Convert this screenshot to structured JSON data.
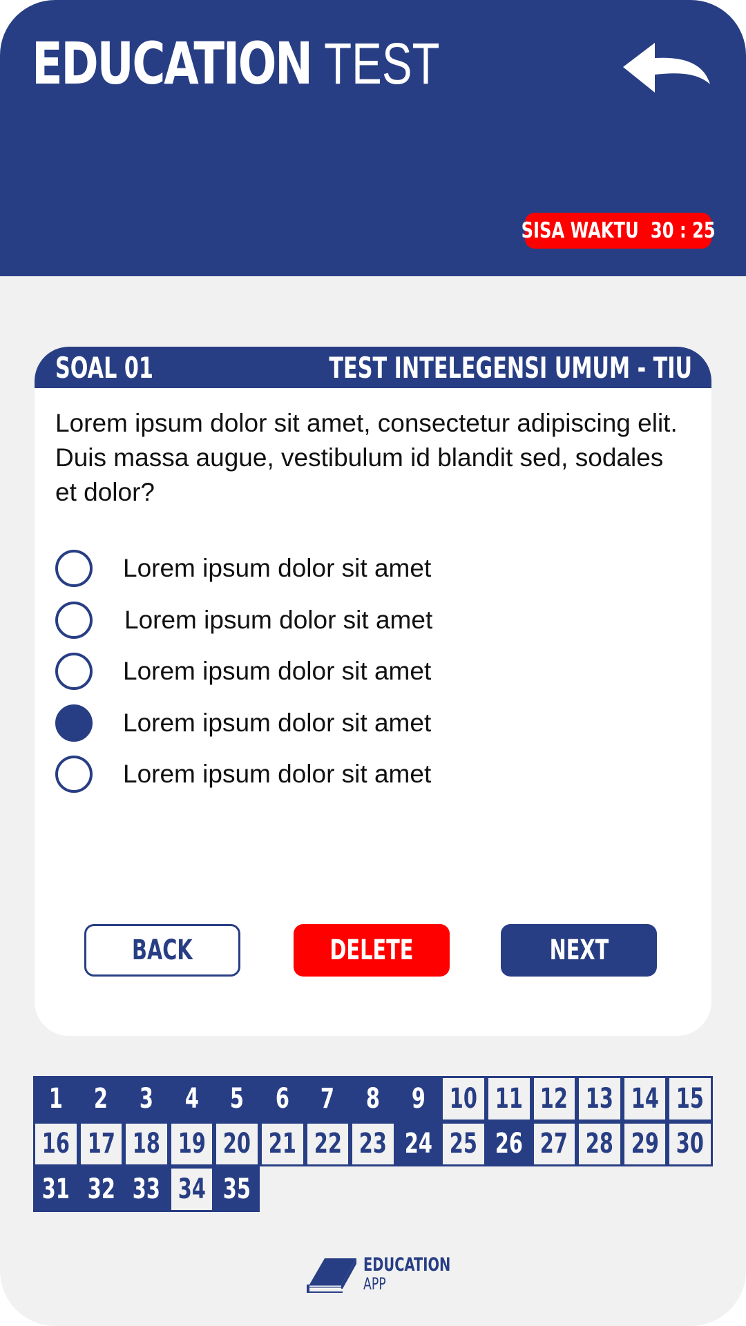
{
  "header": {
    "title_bold": "EDUCATION",
    "title_light": "TEST",
    "back_icon": "back-arrow-icon",
    "timer_label": "SISA WAKTU",
    "timer_value": "30 : 25"
  },
  "question_card": {
    "number_label": "SOAL 01",
    "category": "TEST INTELEGENSI UMUM - TIU",
    "question_text": "Lorem ipsum dolor sit amet, consectetur adipiscing elit. Duis massa augue, vestibulum id blandit sed, sodales et dolor?",
    "options": [
      {
        "label": "Lorem ipsum dolor sit amet",
        "selected": false
      },
      {
        "label": "Lorem ipsum dolor sit amet",
        "selected": false
      },
      {
        "label": "Lorem ipsum dolor sit amet",
        "selected": false
      },
      {
        "label": "Lorem ipsum dolor sit amet",
        "selected": true
      },
      {
        "label": "Lorem ipsum dolor sit amet",
        "selected": false
      }
    ],
    "buttons": {
      "back": "BACK",
      "delete": "DELETE",
      "next": "NEXT"
    }
  },
  "question_grid": {
    "numbers": [
      "1",
      "2",
      "3",
      "4",
      "5",
      "6",
      "7",
      "8",
      "9",
      "10",
      "11",
      "12",
      "13",
      "14",
      "15",
      "16",
      "17",
      "18",
      "19",
      "20",
      "21",
      "22",
      "23",
      "24",
      "25",
      "26",
      "27",
      "28",
      "29",
      "30",
      "31",
      "32",
      "33",
      "34",
      "35"
    ],
    "answered": [
      1,
      2,
      3,
      4,
      5,
      6,
      7,
      8,
      9,
      24,
      26,
      31,
      32,
      33,
      35
    ]
  },
  "footer": {
    "logo_line1": "EDUCATION",
    "logo_line2": "APP",
    "logo_icon": "book-icon"
  },
  "colors": {
    "primary": "#283e84",
    "accent_red": "#ff0000",
    "background": "#f1f1f1",
    "card": "#ffffff"
  }
}
